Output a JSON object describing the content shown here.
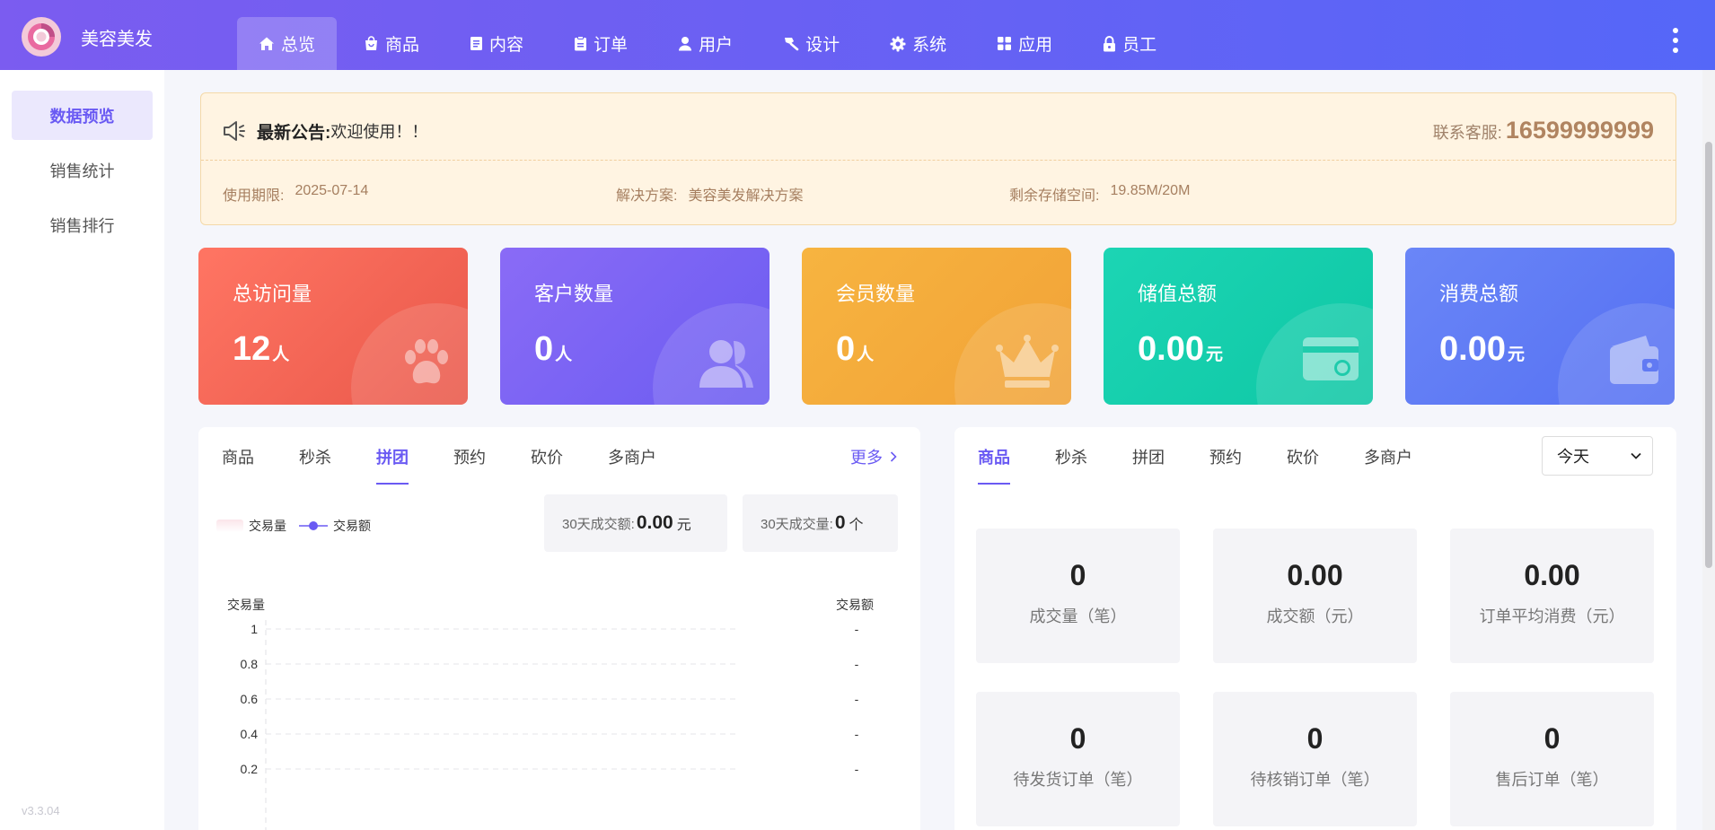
{
  "app": {
    "brand": "美容美发",
    "version": "v3.3.04"
  },
  "nav": {
    "items": [
      {
        "label": "总览",
        "icon": "home-icon"
      },
      {
        "label": "商品",
        "icon": "shopping-bag-icon"
      },
      {
        "label": "内容",
        "icon": "document-icon"
      },
      {
        "label": "订单",
        "icon": "clipboard-icon"
      },
      {
        "label": "用户",
        "icon": "user-icon"
      },
      {
        "label": "设计",
        "icon": "brush-icon"
      },
      {
        "label": "系统",
        "icon": "gear-icon"
      },
      {
        "label": "应用",
        "icon": "apps-grid-icon"
      },
      {
        "label": "员工",
        "icon": "lock-icon"
      }
    ],
    "active": 0
  },
  "sidebar": {
    "items": [
      {
        "label": "数据预览"
      },
      {
        "label": "销售统计"
      },
      {
        "label": "销售排行"
      }
    ],
    "active": 0
  },
  "notice": {
    "title": "最新公告:",
    "text": "欢迎使用！！",
    "contact_label": "联系客服:",
    "contact_phone": "16599999999",
    "expiry_label": "使用期限:",
    "expiry": "2025-07-14",
    "solution_label": "解决方案:",
    "solution": "美容美发解决方案",
    "storage_label": "剩余存储空间:",
    "storage": "19.85M/20M"
  },
  "stats": [
    {
      "label": "总访问量",
      "value": "12",
      "unit": "人",
      "icon": "paw-icon",
      "color": "#f0614f"
    },
    {
      "label": "客户数量",
      "value": "0",
      "unit": "人",
      "icon": "users-icon",
      "color": "#7b63f4"
    },
    {
      "label": "会员数量",
      "value": "0",
      "unit": "人",
      "icon": "crown-icon",
      "color": "#f4ab3d"
    },
    {
      "label": "储值总额",
      "value": "0.00",
      "unit": "元",
      "icon": "card-icon",
      "color": "#13cfae"
    },
    {
      "label": "消费总额",
      "value": "0.00",
      "unit": "元",
      "icon": "wallet-icon",
      "color": "#5b78f4"
    }
  ],
  "left_panel": {
    "tabs": [
      "商品",
      "秒杀",
      "拼团",
      "预约",
      "砍价",
      "多商户"
    ],
    "active_tab": 2,
    "more": "更多",
    "legend": {
      "volume": "交易量",
      "amount": "交易额"
    },
    "amount_30d_label": "30天成交额:",
    "amount_30d": "0.00",
    "amount_30d_unit": "元",
    "volume_30d_label": "30天成交量:",
    "volume_30d": "0",
    "volume_30d_unit": "个"
  },
  "chart_data": {
    "type": "line",
    "y_left_label": "交易量",
    "y_right_label": "交易额",
    "y_ticks": [
      "1",
      "0.8",
      "0.6",
      "0.4",
      "0.2"
    ],
    "y_right_ticks": [
      "-",
      "-",
      "-",
      "-",
      "-"
    ],
    "ylim": [
      0,
      1
    ],
    "grid": true,
    "series": []
  },
  "right_panel": {
    "tabs": [
      "商品",
      "秒杀",
      "拼团",
      "预约",
      "砍价",
      "多商户"
    ],
    "active_tab": 0,
    "period": "今天",
    "metrics": [
      {
        "value": "0",
        "label": "成交量（笔）"
      },
      {
        "value": "0.00",
        "label": "成交额（元）"
      },
      {
        "value": "0.00",
        "label": "订单平均消费（元）"
      },
      {
        "value": "0",
        "label": "待发货订单（笔）"
      },
      {
        "value": "0",
        "label": "待核销订单（笔）"
      },
      {
        "value": "0",
        "label": "售后订单（笔）"
      }
    ]
  }
}
